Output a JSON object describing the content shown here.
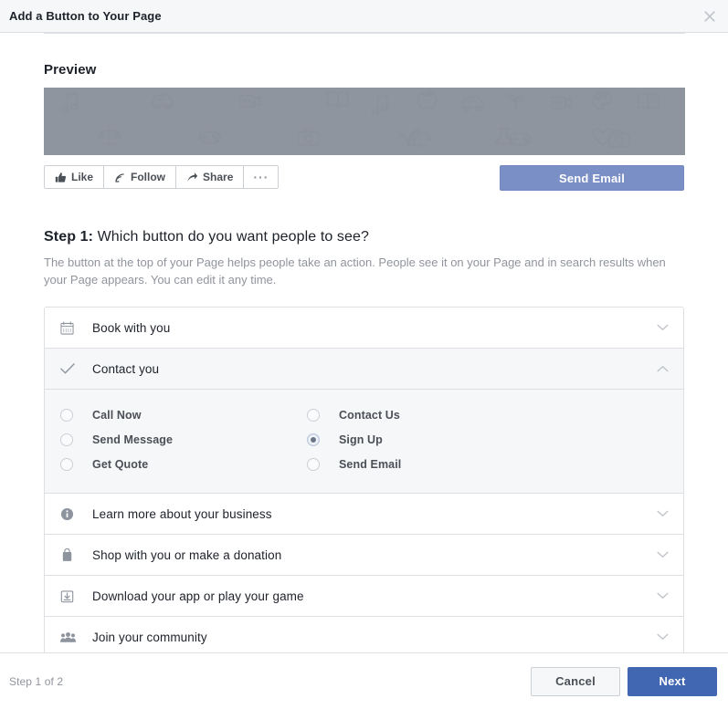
{
  "dialog": {
    "title": "Add a Button to Your Page",
    "close_label": "close-icon"
  },
  "preview": {
    "heading": "Preview",
    "cover_color": "#8f959f",
    "page_buttons": [
      {
        "label": "Like",
        "icon": "thumbs-up-icon"
      },
      {
        "label": "Follow",
        "icon": "follow-icon"
      },
      {
        "label": "Share",
        "icon": "share-arrow-icon"
      },
      {
        "label": "···",
        "icon": "ellipsis-icon"
      }
    ],
    "cta": {
      "label": "Send Email",
      "color": "#7b8fc7"
    }
  },
  "step": {
    "label": "Step 1:",
    "question": "Which button do you want people to see?",
    "description": "The button at the top of your Page helps people take an action. People see it on your Page and in search results when your Page appears. You can edit it any time."
  },
  "accordion": [
    {
      "id": "book-with-you",
      "label": "Book with you",
      "icon": "calendar-icon",
      "expanded": false
    },
    {
      "id": "contact-you",
      "label": "Contact you",
      "icon": "check-icon",
      "expanded": true,
      "options": [
        {
          "label": "Call Now",
          "selected": false
        },
        {
          "label": "Contact Us",
          "selected": false
        },
        {
          "label": "Send Message",
          "selected": false
        },
        {
          "label": "Sign Up",
          "selected": true
        },
        {
          "label": "Get Quote",
          "selected": false
        },
        {
          "label": "Send Email",
          "selected": false
        }
      ]
    },
    {
      "id": "learn-more",
      "label": "Learn more about your business",
      "icon": "info-icon",
      "expanded": false
    },
    {
      "id": "shop-or-donate",
      "label": "Shop with you or make a donation",
      "icon": "shopping-bag-icon",
      "expanded": false
    },
    {
      "id": "download-app",
      "label": "Download your app or play your game",
      "icon": "download-icon",
      "expanded": false
    },
    {
      "id": "join-community",
      "label": "Join your community",
      "icon": "people-icon",
      "expanded": false
    }
  ],
  "footer": {
    "step_count": "Step 1 of 2",
    "cancel_label": "Cancel",
    "next_label": "Next",
    "next_color": "#4267b2"
  }
}
